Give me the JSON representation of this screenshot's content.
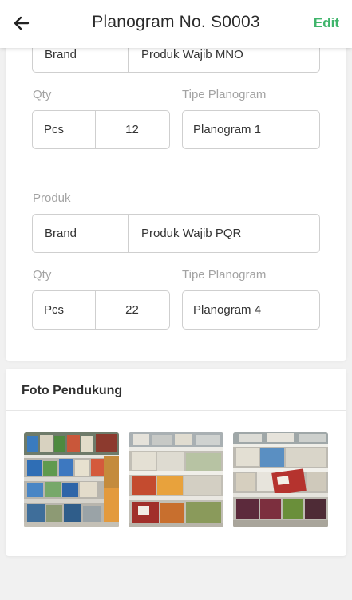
{
  "header": {
    "title": "Planogram No. S0003",
    "edit_label": "Edit"
  },
  "items": [
    {
      "brand_label": "Brand",
      "brand_value": "Produk Wajib MNO",
      "qty_label": "Qty",
      "qty_unit": "Pcs",
      "qty_value": "12",
      "type_label": "Tipe Planogram",
      "type_value": "Planogram 1"
    },
    {
      "product_label": "Produk",
      "brand_label": "Brand",
      "brand_value": "Produk Wajib PQR",
      "qty_label": "Qty",
      "qty_unit": "Pcs",
      "qty_value": "22",
      "type_label": "Tipe Planogram",
      "type_value": "Planogram 4"
    }
  ],
  "photos": {
    "title": "Foto Pendukung",
    "images": [
      {
        "name": "shelf-photo-1"
      },
      {
        "name": "shelf-photo-2"
      },
      {
        "name": "shelf-photo-3"
      }
    ]
  },
  "colors": {
    "accent": "#3fb56b",
    "border": "#cfcfcf",
    "label": "#a3a3a3"
  }
}
